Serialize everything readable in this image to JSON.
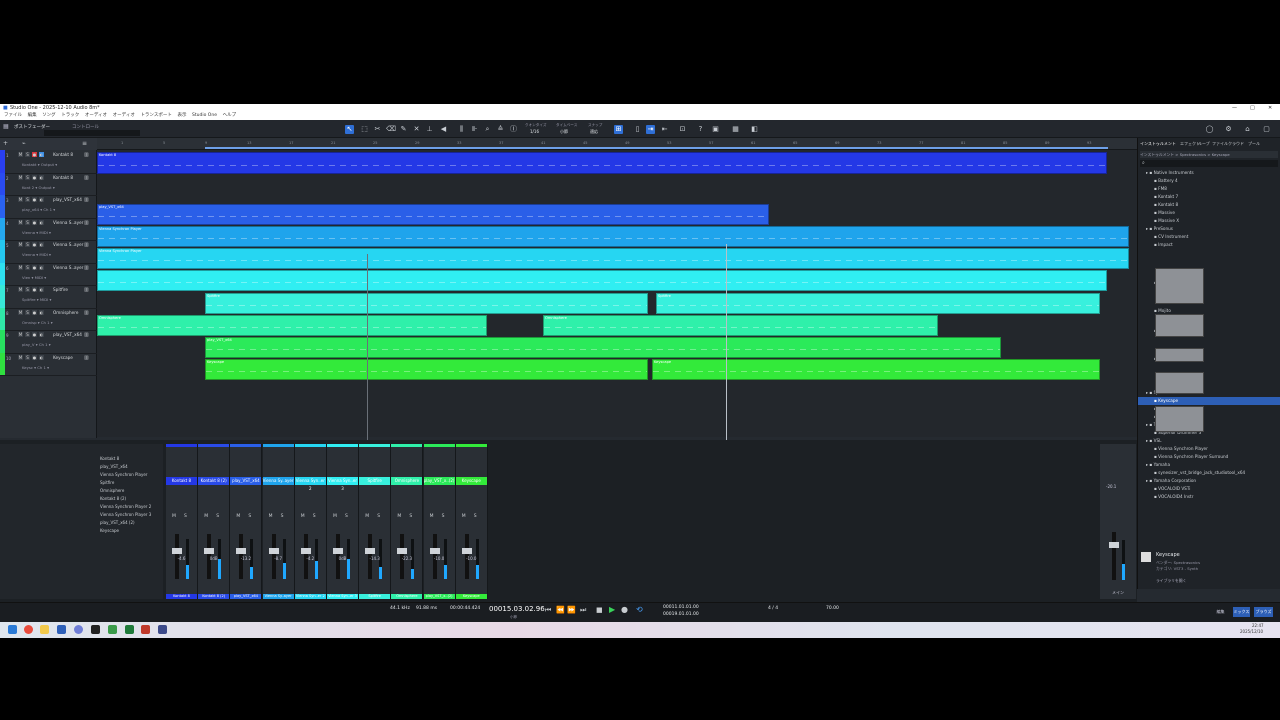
{
  "window": {
    "title": "Studio One - 2025-12-10 Audio 8m*",
    "controls": [
      "—",
      "□",
      "✕"
    ]
  },
  "menu": [
    "ファイル",
    "編集",
    "ソング",
    "トラック",
    "オーディオ",
    "オーディオ",
    "トランスポート",
    "表示",
    "Studio One",
    "ヘルプ"
  ],
  "toolbar": {
    "left_label": "ポストフェーダー",
    "left_sub": "コントロール",
    "quantize_label": "クオンタイズ",
    "quantize_value": "1/16",
    "timebase_label": "タイムベース",
    "timebase_value": "小節",
    "snap_label": "スナップ",
    "snap_value": "適応"
  },
  "ruler_ticks": [
    "1",
    "5",
    "9",
    "13",
    "17",
    "21",
    "25",
    "29",
    "33",
    "37",
    "41",
    "45",
    "49",
    "53",
    "57",
    "61",
    "65",
    "69",
    "73",
    "77",
    "81",
    "85",
    "89",
    "93"
  ],
  "tracks": [
    {
      "num": "1",
      "name": "Kontakt 8",
      "sub": "Kontakt ▾  Output ▾",
      "color": "#2a3ff0"
    },
    {
      "num": "2",
      "name": "Kontakt 8",
      "sub": "Kont 2 ▾  Output ▾",
      "color": "#2a4bf0"
    },
    {
      "num": "3",
      "name": "play_VST_x64",
      "sub": "play_x64 ▾  Ch 1 ▾",
      "color": "#2a62f0"
    },
    {
      "num": "4",
      "name": "Vienna S..ayer",
      "sub": "Vienna ▾  MIDI ▾",
      "color": "#25a8f0"
    },
    {
      "num": "5",
      "name": "Vienna S..ayer",
      "sub": "Vienna ▾  MIDI ▾",
      "color": "#25c8f0"
    },
    {
      "num": "6",
      "name": "Vienna S..ayer",
      "sub": "Vien ▾  MIDI ▾",
      "color": "#2ee0f0"
    },
    {
      "num": "7",
      "name": "Spitfire",
      "sub": "Spitfire ▾  MIDI ▾",
      "color": "#38e8d8"
    },
    {
      "num": "8",
      "name": "Omnisphere",
      "sub": "Omnisp ▾  Ch 1 ▾",
      "color": "#30e8a8"
    },
    {
      "num": "9",
      "name": "play_VST_x64",
      "sub": "play_V ▾  Ch 1 ▾",
      "color": "#28e060"
    },
    {
      "num": "10",
      "name": "Keyscape",
      "sub": "Keysc ▾  Ch 1 ▾",
      "color": "#30e040"
    }
  ],
  "clips": [
    {
      "label": "Kontakt 8",
      "color": "#2438e6"
    },
    {
      "label": "play_VST_x64",
      "color": "#2a5fe8"
    },
    {
      "label": "Vienna Synchron Player",
      "color": "#1fa4ec"
    },
    {
      "label": "Vienna Synchron Player",
      "color": "#26d6f2"
    },
    {
      "label": "",
      "color": "#30eef2"
    },
    {
      "label": "Spitfire",
      "color": "#38f0dd"
    },
    {
      "label": "Spitfire",
      "color": "#38f0dd"
    },
    {
      "label": "Omnisphere",
      "color": "#2ff0aa"
    },
    {
      "label": "Omnisphere",
      "color": "#2ff0aa"
    },
    {
      "label": "play_VST_x64",
      "color": "#2bea5a"
    },
    {
      "label": "Keyscape",
      "color": "#33ea3a"
    },
    {
      "label": "Keyscape",
      "color": "#33ea3a"
    }
  ],
  "browser": {
    "tabs": [
      "インストゥルメント",
      "エフェクト",
      "ループ",
      "ファイル",
      "クラウド",
      "プール"
    ],
    "path": "インストゥルメント  >  Spectrasonics  >  Keyscape",
    "items": [
      {
        "label": "Native Instruments",
        "indent": 1,
        "folder": true
      },
      {
        "label": "Battery 4",
        "indent": 2
      },
      {
        "label": "FM8",
        "indent": 2
      },
      {
        "label": "Kontakt 7",
        "indent": 2
      },
      {
        "label": "Kontakt 8",
        "indent": 2
      },
      {
        "label": "Massive",
        "indent": 2
      },
      {
        "label": "Massive X",
        "indent": 2
      },
      {
        "label": "PreSonus",
        "indent": 1,
        "folder": true
      },
      {
        "label": "CV Instrument",
        "indent": 2
      },
      {
        "label": "Impact",
        "indent": 2
      },
      {
        "label": "Mai Tai",
        "indent": 2
      },
      {
        "label": "Mojito",
        "indent": 2
      },
      {
        "label": "Presence",
        "indent": 2
      },
      {
        "label": "SampleOne",
        "indent": 2
      },
      {
        "label": "Spectrasonics",
        "indent": 1,
        "folder": true
      },
      {
        "label": "Keyscape",
        "indent": 2,
        "selected": true
      },
      {
        "label": "Omnisphere",
        "indent": 2
      },
      {
        "label": "Trilian",
        "indent": 2
      },
      {
        "label": "Toontrack",
        "indent": 1,
        "folder": true
      },
      {
        "label": "Superior Drummer 3",
        "indent": 2
      },
      {
        "label": "VSL",
        "indent": 1,
        "folder": true
      },
      {
        "label": "Vienna Synchron Player",
        "indent": 2
      },
      {
        "label": "Vienna Synchron Player Surround",
        "indent": 2
      },
      {
        "label": "Yamaha",
        "indent": 1,
        "folder": true
      },
      {
        "label": "synesizer_vst_bridge_jack_studiotool_x64",
        "indent": 2
      },
      {
        "label": "Yamaha Corporation",
        "indent": 1,
        "folder": true
      },
      {
        "label": "VOCALOID VSTi",
        "indent": 2
      },
      {
        "label": "VOCALOID4 Instr",
        "indent": 2
      }
    ],
    "info_title": "Keyscape",
    "info_vendor": "ベンダー: Spectrasonics",
    "info_type": "カテゴリ: VST3 - Synth",
    "info_extra": "ライブラリを開く"
  },
  "mixer_list": [
    "Kontakt 8",
    "play_VST_x64",
    "Vienna Synchron Player",
    "Spitfire",
    "Omnisphere",
    "Kontakt 8 (2)",
    "Vienna Synchron Player 2",
    "Vienna Synchron Player 3",
    "play_VST_x64 (2)",
    "Keyscape"
  ],
  "mixer_strips": [
    {
      "name": "Kontakt 8",
      "gain": "-4.6",
      "color": "#2438e6",
      "level": 0.35
    },
    {
      "name": "Kontakt 8 (2)",
      "gain": "0dB",
      "color": "#2a4be8",
      "level": 0.5
    },
    {
      "name": "play_VST_x64",
      "gain": "-13.2",
      "color": "#2a5fe8",
      "level": 0.3
    },
    {
      "name": "Vienna Sy..ayer",
      "gain": "-8.7",
      "color": "#1fa4ec",
      "level": 0.4
    },
    {
      "name": "Vienna Syn..er 2",
      "gain": "-4.2",
      "color": "#26d6f2",
      "level": 0.45
    },
    {
      "name": "Vienna Syn..er 3",
      "gain": "0dB",
      "color": "#30eef2",
      "level": 0.5
    },
    {
      "name": "Spitfire",
      "gain": "-14.3",
      "color": "#38f0dd",
      "level": 0.3
    },
    {
      "name": "Omnisphere",
      "gain": "-22.3",
      "color": "#2ff0aa",
      "level": 0.25
    },
    {
      "name": "play_VST_x..(2)",
      "gain": "-10.0",
      "color": "#2bea5a",
      "level": 0.35
    },
    {
      "name": "Keyscape",
      "gain": "-10.0",
      "color": "#33ea3a",
      "level": 0.35
    }
  ],
  "master": {
    "name": "メイン",
    "gain": "-20.1"
  },
  "transport": {
    "sample_rate": "44.1 kHz",
    "latency": "91.88 ms",
    "time": "00:00:44.424",
    "position": "00015.03.02.96",
    "position_sub": "小節",
    "loop_start": "00011.01.01.00",
    "loop_end": "00019.01.01.00",
    "signature": "4 / 4",
    "tempo": "70.00",
    "mix_label": "ミックス",
    "browse_label": "ブラウズ",
    "edit_label": "編集"
  },
  "taskbar_time": "22:47",
  "taskbar_date": "2025/12/10"
}
